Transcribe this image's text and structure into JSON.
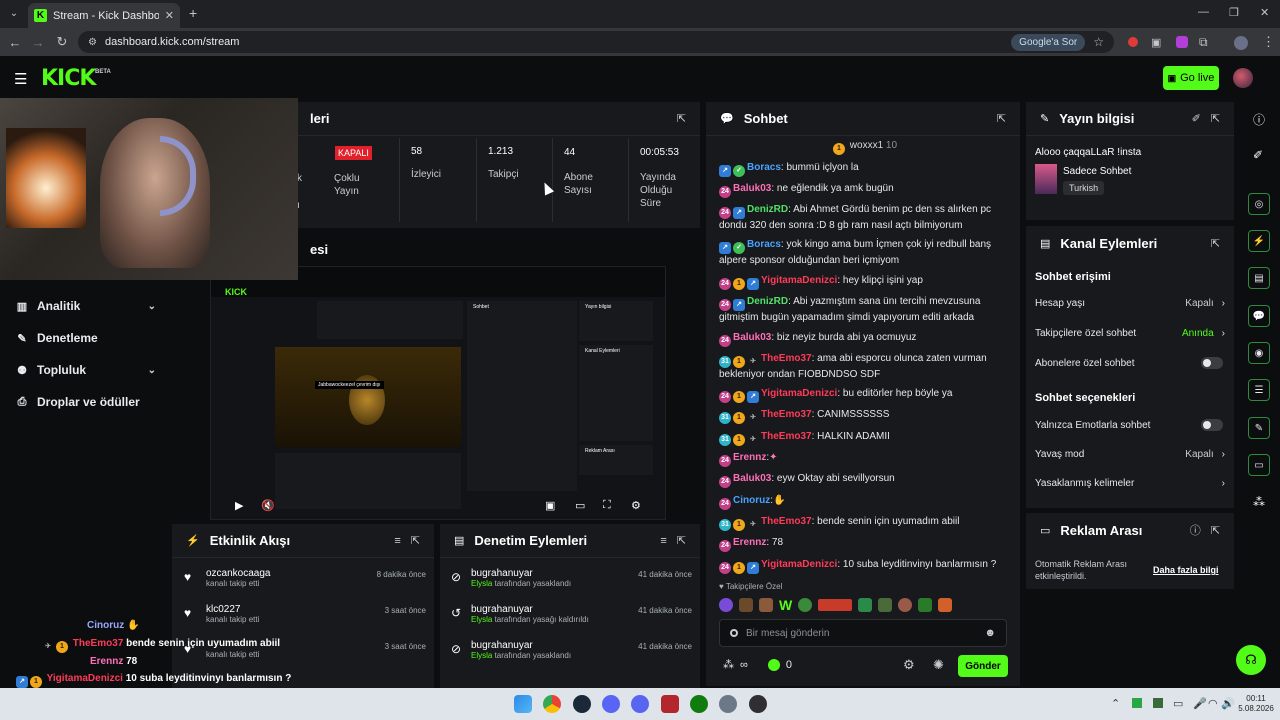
{
  "browser": {
    "tab_title": "Stream - Kick Dashboard",
    "url": "dashboard.kick.com/stream",
    "google_lens": "Google'a Sor"
  },
  "app": {
    "logo": "KICK",
    "beta": "BETA",
    "go_live": "Go live"
  },
  "nav": {
    "items": [
      {
        "label": "Analitik"
      },
      {
        "label": "Denetleme"
      },
      {
        "label": "Topluluk"
      },
      {
        "label": "Droplar ve ödüller"
      }
    ]
  },
  "stats_panel": {
    "title_fragment": "leri",
    "fragment_k": "k",
    "fragment_i": "ı",
    "closed_badge": "KAPALI",
    "closed_label": "Çoklu Yayın",
    "viewers_value": "58",
    "viewers_label": "İzleyici",
    "followers_value": "1.213",
    "followers_label": "Takipçi",
    "subs_value": "44",
    "subs_label": "Abone Sayısı",
    "duration_value": "00:05:53",
    "duration_label": "Yayında Olduğu Süre"
  },
  "preview_panel": {
    "title_fragment": "esi"
  },
  "chat": {
    "title": "Sohbet",
    "pinned_user": "woxxx1",
    "pinned_count": "10",
    "messages": [
      {
        "user": "Boracs",
        "text": ": bummü içlyon la"
      },
      {
        "user": "Baluk03",
        "text": ": ne eğlendik ya amk bugün"
      },
      {
        "user": "DenizRD",
        "text": ": Abi Ahmet Gördü benim pc den ss alırken pc dondu 320 den sonra :D 8 gb ram nasıl açtı bilmiyorum"
      },
      {
        "user": "Boracs",
        "text": ": yok kingo ama bum İçmen çok iyi redbull banş alpere sponsor olduğundan beri içmiyom"
      },
      {
        "user": "YigitamaDenizci",
        "text": ": hey klipçi işini yap"
      },
      {
        "user": "DenizRD",
        "text": ": Abi yazmıştım sana ünı tercihi mevzusuna gitmiştim bugün yapamadım şimdi yapıyorum editi arkada"
      },
      {
        "user": "Baluk03",
        "text": ": biz neyiz burda abi ya ocmuyuz"
      },
      {
        "user": "TheEmo37",
        "text": ": ama abi esporcu olunca zaten vurman bekleniyor ondan FIOBDNDSO SDF"
      },
      {
        "user": "YigitamaDenizci",
        "text": ": bu editörler hep böyle ya"
      },
      {
        "user": "TheEmo37",
        "text": ": CANIMSSSSSS"
      },
      {
        "user": "TheEmo37",
        "text": ": HALKIN ADAMII"
      },
      {
        "user": "Erennz",
        "text": ":"
      },
      {
        "user": "Baluk03",
        "text": ": eyw Oktay abi sevillyorsun"
      },
      {
        "user": "Cinoruz",
        "text": ":"
      },
      {
        "user": "TheEmo37",
        "text": ": bende senin için uyumadım abiil"
      },
      {
        "user": "Erennz",
        "text": ": 78"
      },
      {
        "user": "YigitamaDenizci",
        "text": ": 10 suba leyditinvinyı banlarmısın ?"
      }
    ],
    "followers_only": "Takipçilere Özel",
    "input_placeholder": "Bir mesaj gönderin",
    "infinity": "∞",
    "kick_count": "0",
    "send_label": "Gönder"
  },
  "stream_info": {
    "title": "Yayın bilgisi",
    "stream_title": "Alooo çaqqaLLaR !insta",
    "category": "Sadece Sohbet",
    "tag": "Turkish"
  },
  "channel_actions": {
    "title": "Kanal Eylemleri",
    "chat_access": "Sohbet erişimi",
    "account_age": "Hesap yaşı",
    "account_age_val": "Kapalı",
    "followers_chat": "Takipçilere özel sohbet",
    "followers_chat_val": "Anında",
    "subs_chat": "Abonelere özel sohbet",
    "chat_options": "Sohbet seçenekleri",
    "emotes_only": "Yalnızca Emotlarla sohbet",
    "slow_mode": "Yavaş mod",
    "slow_mode_val": "Kapalı",
    "banned_words": "Yasaklanmış kelimeler"
  },
  "ad_break": {
    "title": "Reklam Arası",
    "status": "Otomatik Reklam Arası etkinleştirildi.",
    "more": "Daha fazla bilgi"
  },
  "activity": {
    "title": "Etkinlik Akışı",
    "items": [
      {
        "user": "ozcankocaaga",
        "sub": "kanalı takip etti",
        "time": "8 dakika önce"
      },
      {
        "user": "klc0227",
        "sub": "kanalı takip etti",
        "time": "3 saat önce"
      },
      {
        "user": "",
        "sub": "kanalı takip etti",
        "time": "3 saat önce"
      }
    ]
  },
  "moderation": {
    "title": "Denetim Eylemleri",
    "items": [
      {
        "user": "bugrahanuyar",
        "by": "Elysla",
        "sub": " tarafından yasaklandı",
        "time": "41 dakika önce"
      },
      {
        "user": "bugrahanuyar",
        "by": "Elysla",
        "sub": " tarafından yasağı kaldırıldı",
        "time": "41 dakika önce"
      },
      {
        "user": "bugrahanuyar",
        "by": "Elysla",
        "sub": " tarafından yasaklandı",
        "time": "41 dakika önce"
      }
    ]
  },
  "overlay_chat": [
    {
      "user": "Cinoruz",
      "text": ""
    },
    {
      "user": "TheEmo37",
      "text": "bende senin için uyumadım abiil"
    },
    {
      "user": "Erennz",
      "text": "78"
    },
    {
      "user": "YigitamaDenizci",
      "text": "10 suba leyditinvinyı banlarmısın ?"
    }
  ],
  "preview_inner": {
    "logo": "KICK",
    "chat": "Sohbet",
    "info": "Yayın bilgisi",
    "actions": "Kanal Eylemleri",
    "ad": "Reklam Arası",
    "offline_text": "Jabbawockeezel çevrim dışı"
  },
  "taskbar": {
    "time": "00:11",
    "date": "5.08.2026"
  },
  "colors": {
    "kick_green": "#53fc18",
    "panel": "#17191c",
    "bg": "#0b0d0f"
  }
}
